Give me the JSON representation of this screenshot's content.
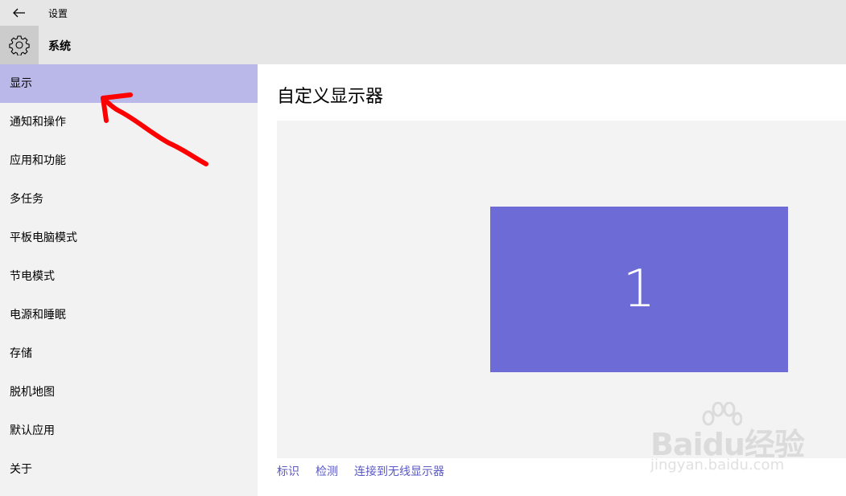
{
  "window": {
    "title": "设置"
  },
  "header": {
    "title": "系统"
  },
  "sidebar": {
    "items": [
      {
        "label": "显示",
        "active": true
      },
      {
        "label": "通知和操作"
      },
      {
        "label": "应用和功能"
      },
      {
        "label": "多任务"
      },
      {
        "label": "平板电脑模式"
      },
      {
        "label": "节电模式"
      },
      {
        "label": "电源和睡眠"
      },
      {
        "label": "存储"
      },
      {
        "label": "脱机地图"
      },
      {
        "label": "默认应用"
      },
      {
        "label": "关于"
      }
    ]
  },
  "main": {
    "title": "自定义显示器",
    "monitor_number": "1",
    "links": [
      "标识",
      "检测",
      "连接到无线显示器"
    ]
  },
  "watermark": {
    "brand": "Baidu经验",
    "site": "jingyan.baidu.com"
  },
  "colors": {
    "accent": "#6d6bd6",
    "active_nav": "#b9b8e8",
    "link": "#5a58c4",
    "annotation": "#ff0000"
  }
}
